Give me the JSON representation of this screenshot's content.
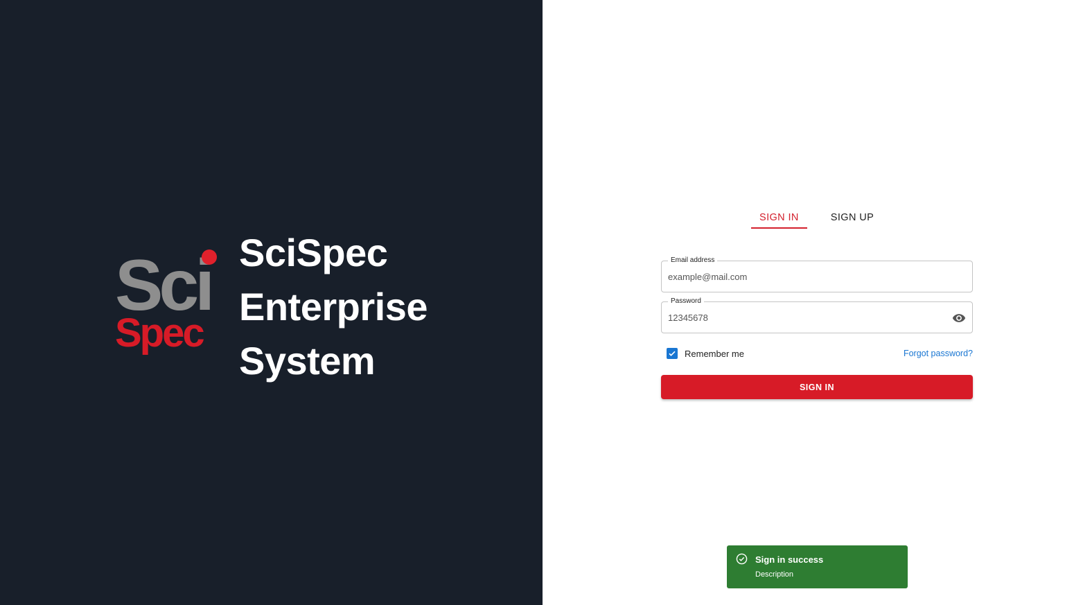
{
  "brand": {
    "logo_top": "Sci",
    "logo_bottom": "Spec",
    "title_line1": "SciSpec",
    "title_line2": "Enterprise",
    "title_line3": "System"
  },
  "tabs": [
    {
      "label": "SIGN IN",
      "active": true
    },
    {
      "label": "SIGN UP",
      "active": false
    }
  ],
  "form": {
    "email": {
      "label": "Email address",
      "value": "example@mail.com"
    },
    "password": {
      "label": "Password",
      "value": "12345678"
    },
    "remember_label": "Remember me",
    "remember_checked": true,
    "forgot_label": "Forgot password?",
    "submit_label": "SIGN IN"
  },
  "toast": {
    "title": "Sign in success",
    "description": "Description",
    "icon": "check-circle-icon"
  },
  "colors": {
    "left_bg": "#181f2a",
    "accent": "#d71b27",
    "link": "#1976d2",
    "success": "#2e7d32"
  }
}
